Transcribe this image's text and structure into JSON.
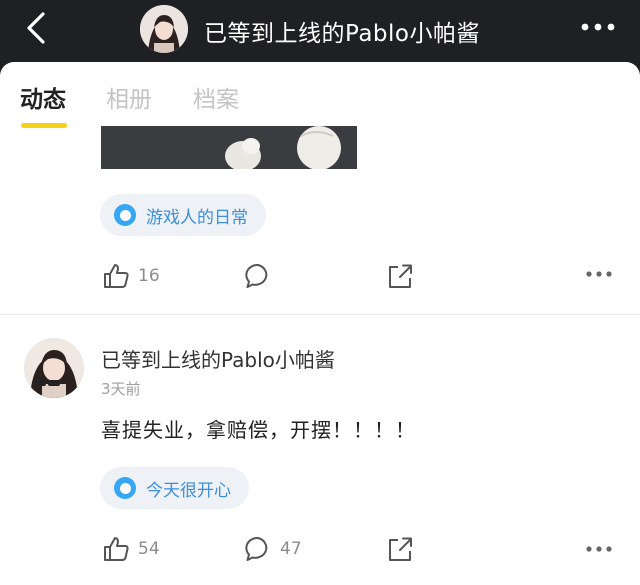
{
  "header": {
    "title": "已等到上线的Pablo小帕酱",
    "back_icon": "chevron-left-icon",
    "more_icon": "more-horizontal-icon"
  },
  "tabs": [
    {
      "label": "动态",
      "active": true
    },
    {
      "label": "相册",
      "active": false
    },
    {
      "label": "档案",
      "active": false
    }
  ],
  "post1": {
    "topic": "游戏人的日常",
    "likes": "16",
    "comments": ""
  },
  "post2": {
    "author": "已等到上线的Pablo小帕酱",
    "time": "3天前",
    "text": "喜提失业，拿赔偿，开摆！！！！",
    "topic": "今天很开心",
    "likes": "54",
    "comments": "47"
  },
  "colors": {
    "accent_yellow": "#f5d213",
    "topic_blue": "#36a7f5",
    "header_bg": "#1f2023"
  }
}
